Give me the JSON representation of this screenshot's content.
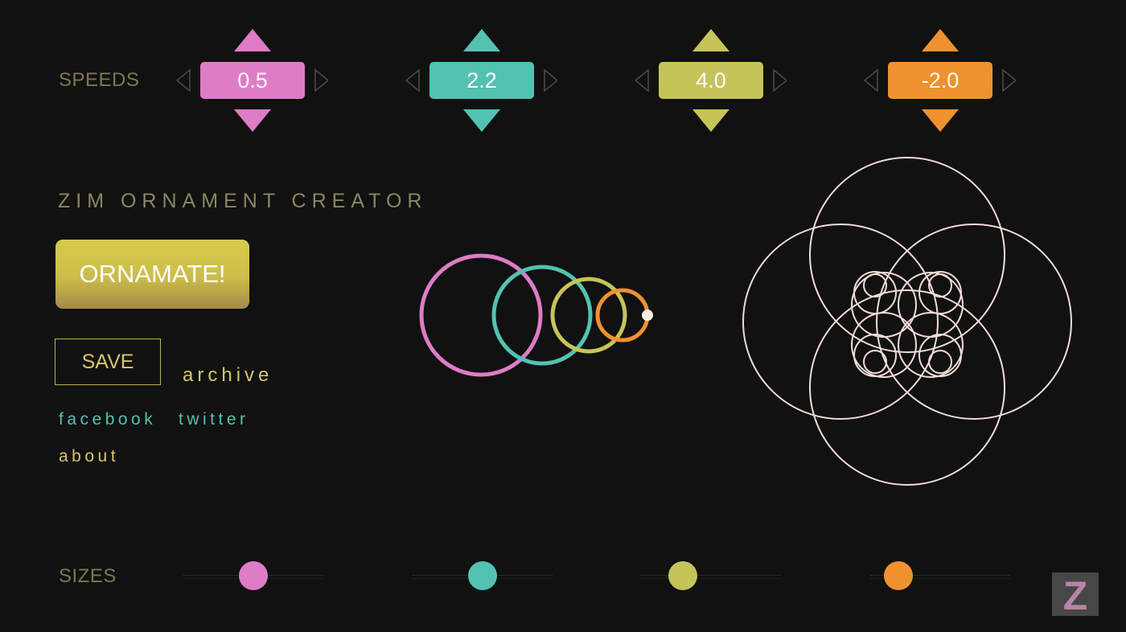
{
  "labels": {
    "speeds": "SPEEDS",
    "sizes": "SIZES",
    "title": "ZIM ORNAMENT CREATOR"
  },
  "buttons": {
    "ornamate": "ORNAMATE!",
    "save": "SAVE"
  },
  "links": {
    "archive": "archive",
    "facebook": "facebook",
    "twitter": "twitter",
    "about": "about"
  },
  "speeds": [
    {
      "value": "0.5",
      "color": "#de7cc6"
    },
    {
      "value": "2.2",
      "color": "#53c2b2"
    },
    {
      "value": "4.0",
      "color": "#c5c45a"
    },
    {
      "value": "-2.0",
      "color": "#f0912f"
    }
  ],
  "sizes": [
    {
      "level": 0.5,
      "color": "#de7cc6"
    },
    {
      "level": 0.5,
      "color": "#53c2b2"
    },
    {
      "level": 0.3,
      "color": "#c5c45a"
    },
    {
      "level": 0.2,
      "color": "#f0912f"
    }
  ],
  "colors": {
    "background": "#111111",
    "label": "#7d7750",
    "link_gold": "#d8c46a",
    "link_teal": "#53c2b2",
    "ornament_stroke": "#f3dcd6",
    "arrow_gray": "#4a4a4a"
  },
  "logo": {
    "letter": "Z",
    "icon": "zim-logo"
  }
}
